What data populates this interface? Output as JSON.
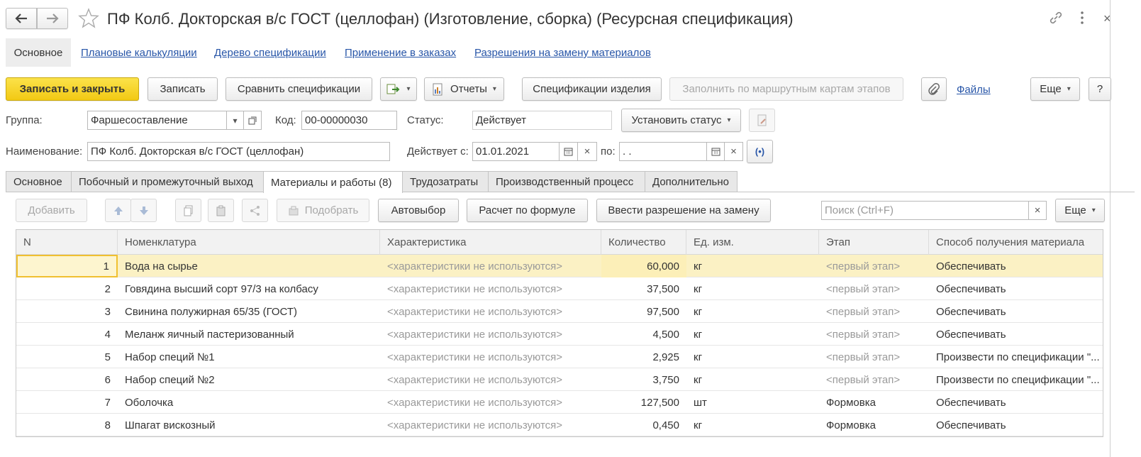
{
  "window": {
    "title": "ПФ Колб. Докторская  в/с  ГОСТ (целлофан) (Изготовление, сборка) (Ресурсная спецификация)"
  },
  "nav_links": [
    {
      "label": "Основное"
    },
    {
      "label": "Плановые калькуляции"
    },
    {
      "label": "Дерево спецификации"
    },
    {
      "label": "Применение в заказах"
    },
    {
      "label": "Разрешения на замену материалов"
    }
  ],
  "toolbar": {
    "save_close": "Записать и закрыть",
    "save": "Записать",
    "compare": "Сравнить спецификации",
    "reports": "Отчеты",
    "item_specs": "Спецификации изделия",
    "fill_routes": "Заполнить по маршрутным картам этапов",
    "files": "Файлы",
    "more": "Еще",
    "help": "?"
  },
  "form": {
    "group_label": "Группа:",
    "group_value": "Фаршесоставление",
    "code_label": "Код:",
    "code_value": "00-00000030",
    "status_label": "Статус:",
    "status_value": "Действует",
    "set_status": "Установить статус",
    "name_label": "Наименование:",
    "name_value": "ПФ Колб. Докторская  в/с  ГОСТ (целлофан)",
    "valid_from_label": "Действует с:",
    "valid_from_value": "01.01.2021",
    "to_label": "по:",
    "to_value": " .  ."
  },
  "tabs": [
    {
      "label": "Основное"
    },
    {
      "label": "Побочный и промежуточный выход"
    },
    {
      "label": "Материалы и работы (8)"
    },
    {
      "label": "Трудозатраты"
    },
    {
      "label": "Производственный процесс"
    },
    {
      "label": "Дополнительно"
    }
  ],
  "table_toolbar": {
    "add": "Добавить",
    "pick": "Подобрать",
    "autoselect": "Автовыбор",
    "formula": "Расчет по формуле",
    "replacement": "Ввести разрешение на замену",
    "search_placeholder": "Поиск (Ctrl+F)",
    "more": "Еще"
  },
  "table": {
    "columns": [
      "N",
      "Номенклатура",
      "Характеристика",
      "Количество",
      "Ед. изм.",
      "Этап",
      "Способ получения материала"
    ],
    "rows": [
      {
        "n": "1",
        "name": "Вода на сырье",
        "char": "<характеристики не используются>",
        "qty": "60,000",
        "unit": "кг",
        "stage": "<первый этап>",
        "method": "Обеспечивать"
      },
      {
        "n": "2",
        "name": "Говядина высший сорт 97/3 на колбасу",
        "char": "<характеристики не используются>",
        "qty": "37,500",
        "unit": "кг",
        "stage": "<первый этап>",
        "method": "Обеспечивать"
      },
      {
        "n": "3",
        "name": "Свинина полужирная 65/35 (ГОСТ)",
        "char": "<характеристики не используются>",
        "qty": "97,500",
        "unit": "кг",
        "stage": "<первый этап>",
        "method": "Обеспечивать"
      },
      {
        "n": "4",
        "name": "Меланж яичный пастеризованный",
        "char": "<характеристики не используются>",
        "qty": "4,500",
        "unit": "кг",
        "stage": "<первый этап>",
        "method": "Обеспечивать"
      },
      {
        "n": "5",
        "name": "Набор специй №1",
        "char": "<характеристики не используются>",
        "qty": "2,925",
        "unit": "кг",
        "stage": "<первый этап>",
        "method": "Произвести по спецификации \"..."
      },
      {
        "n": "6",
        "name": "Набор специй №2",
        "char": "<характеристики не используются>",
        "qty": "3,750",
        "unit": "кг",
        "stage": "<первый этап>",
        "method": "Произвести по спецификации \"..."
      },
      {
        "n": "7",
        "name": "Оболочка",
        "char": "<характеристики не используются>",
        "qty": "127,500",
        "unit": "шт",
        "stage": "Формовка",
        "method": "Обеспечивать"
      },
      {
        "n": "8",
        "name": "Шпагат вискозный",
        "char": "<характеристики не используются>",
        "qty": "0,450",
        "unit": "кг",
        "stage": "Формовка",
        "method": "Обеспечивать"
      }
    ]
  },
  "colors": {
    "primary_button": "#f2c914",
    "link": "#2856a8",
    "selected_row": "#fbf1c4"
  }
}
